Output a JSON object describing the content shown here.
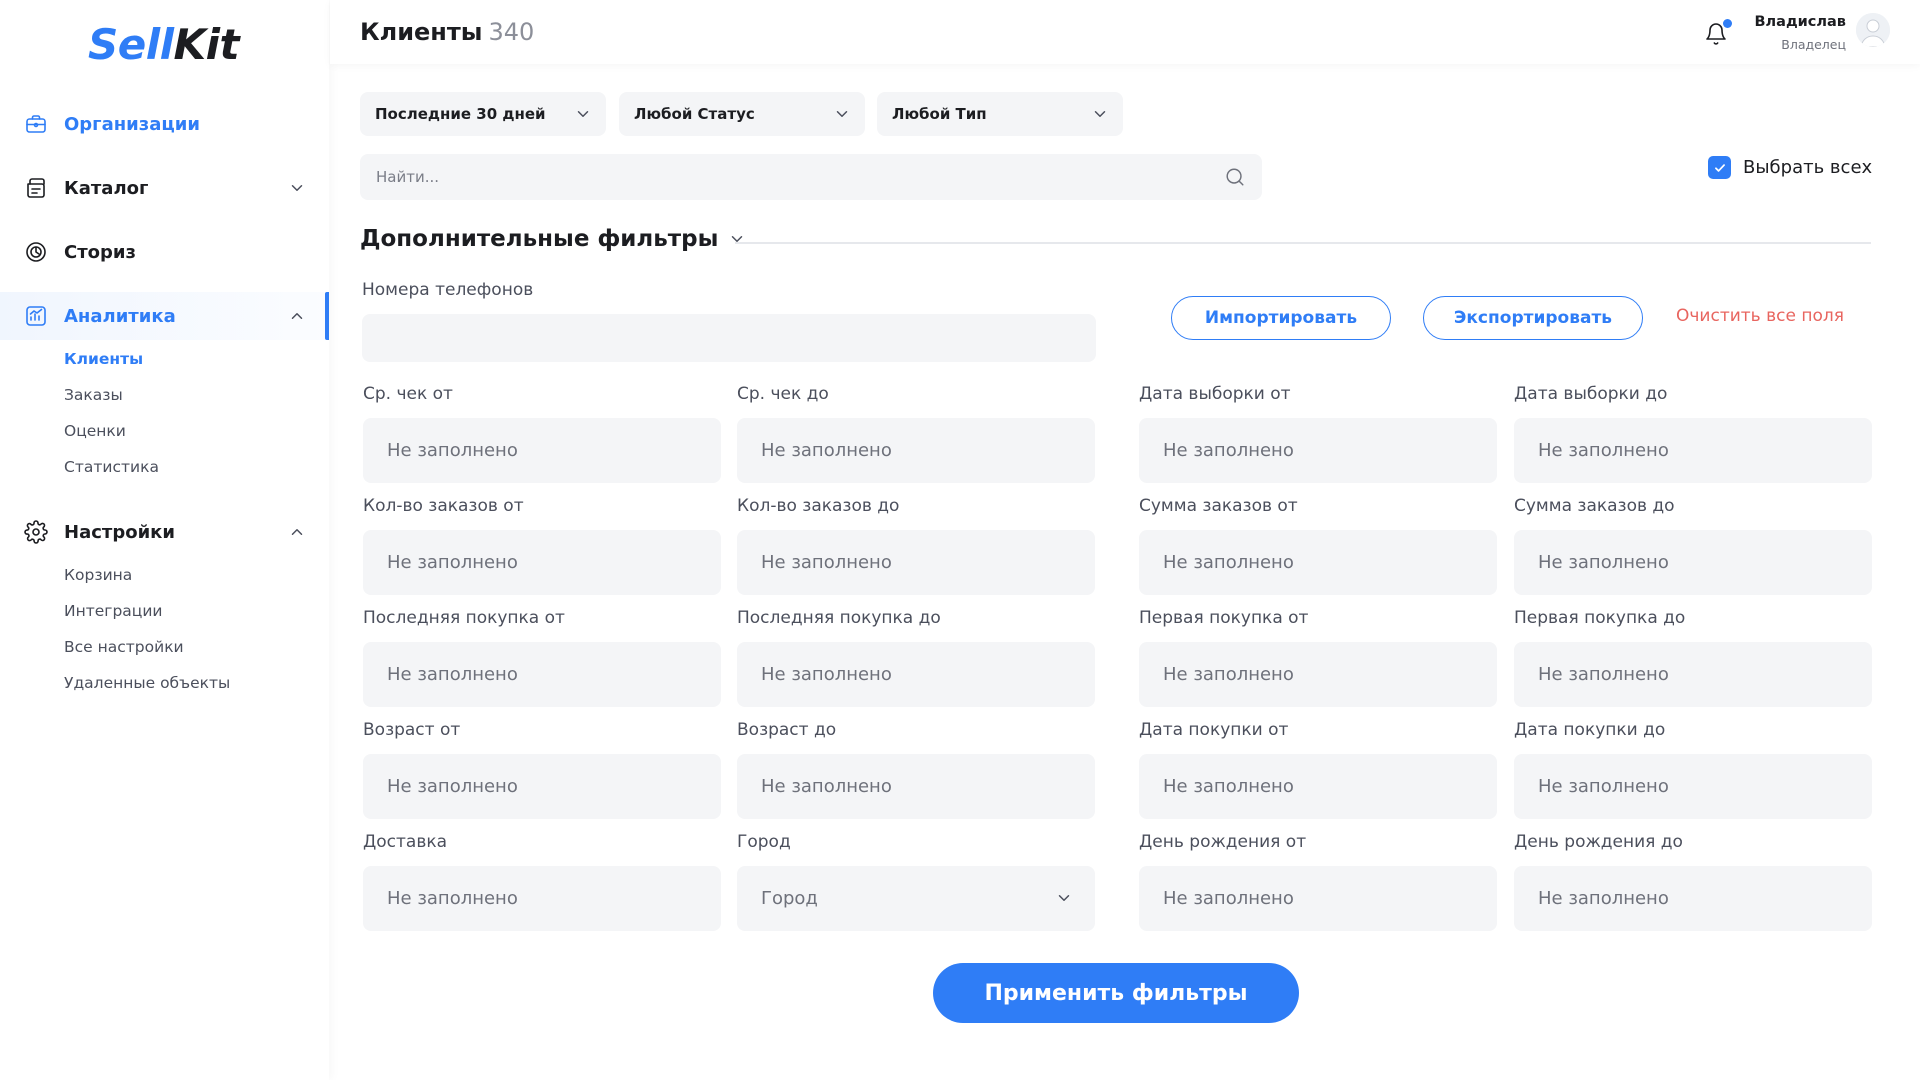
{
  "brand": {
    "part1": "Sell",
    "part2": "Kit"
  },
  "sidebar": {
    "items": [
      {
        "label": "Организации",
        "icon": "briefcase-icon"
      },
      {
        "label": "Каталог",
        "icon": "catalog-icon"
      },
      {
        "label": "Сториз",
        "icon": "stories-icon"
      },
      {
        "label": "Аналитика",
        "icon": "analytics-icon"
      },
      {
        "label": "Настройки",
        "icon": "gear-icon"
      }
    ],
    "analytics_sub": [
      "Клиенты",
      "Заказы",
      "Оценки",
      "Статистика"
    ],
    "settings_sub": [
      "Корзина",
      "Интеграции",
      "Все настройки",
      "Удаленные объекты"
    ]
  },
  "header": {
    "title": "Клиенты",
    "count": "340",
    "user_name": "Владислав",
    "user_role": "Владелец"
  },
  "filters": {
    "period": "Последние 30 дней",
    "status": "Любой Статус",
    "type": "Любой Тип",
    "search_placeholder": "Найти...",
    "select_all": "Выбрать всех",
    "select_all_checked": true,
    "advanced_title": "Дополнительные фильтры",
    "phones_label": "Номера телефонов",
    "import_label": "Импортировать",
    "export_label": "Экспортировать",
    "clear_label": "Очистить все поля",
    "apply_label": "Применить фильтры",
    "empty_placeholder": "Не заполнено",
    "city_placeholder": "Город"
  },
  "fields": [
    "Ср. чек от",
    "Ср. чек до",
    "Дата выборки от",
    "Дата выборки до",
    "Кол-во заказов от",
    "Кол-во заказов до",
    "Сумма заказов от",
    "Сумма заказов до",
    "Последняя покупка от",
    "Последняя покупка до",
    "Первая покупка от",
    "Первая покупка до",
    "Возраст от",
    "Возраст до",
    "Дата покупки от",
    "Дата покупки до",
    "Доставка",
    "Город",
    "День рождения от",
    "День рождения до"
  ],
  "colors": {
    "accent": "#2f7df6",
    "danger": "#e8655f",
    "field_bg": "#f4f5f7"
  }
}
